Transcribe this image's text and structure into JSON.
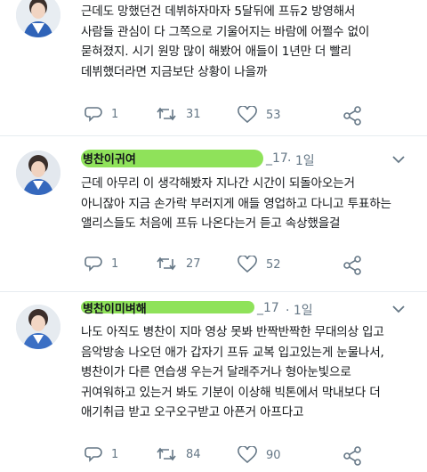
{
  "tweets": [
    {
      "name": "",
      "handle": "",
      "time": "",
      "lines": [
        "근데도 망했던건 데뷔하자마자 5달뒤에 프듀2 방영해서",
        "사람들 관심이 다 그쪽으로 기울어지는 바람에 어쩔수 없이",
        "묻혀졌지. 시기 원망 많이 해봤어 애들이 1년만 더 빨리",
        "데뷔했더라면 지금보단 상황이 나을까"
      ],
      "replies": "1",
      "retweets": "31",
      "likes": "53"
    },
    {
      "name": "병찬이귀여",
      "handle": "_17",
      "time": "· 1일",
      "lines": [
        "근데 아무리 이 생각해봤자 지나간 시간이 되돌아오는거",
        "아니잖아 지금 손가락 부러지게 애들 영업하고 다니고 투표하는",
        "앨리스들도 처음에 프듀 나온다는거 듣고 속상했을걸"
      ],
      "replies": "1",
      "retweets": "27",
      "likes": "52"
    },
    {
      "name": "병찬이미벼해",
      "handle": "_17",
      "time": "· 1일",
      "lines": [
        "나도 아직도 병찬이 지마 영상 못봐 반짝반짝한 무대의상 입고",
        "음악방송 나오던 애가 갑자기 프듀 교복 입고있는게 눈물나서,",
        "병찬이가 다른 연습생 우는거 달래주거나 형아눈빛으로",
        "귀여워하고 있는거 봐도 기분이 이상해 빅톤에서 막내보다 더",
        "애기취급 받고 오구오구받고 아픈거 아프다고"
      ],
      "replies": "1",
      "retweets": "84",
      "likes": "90"
    }
  ],
  "colors": {
    "highlight": "#8fe25a",
    "icon": "#657786",
    "text": "#14171a"
  }
}
